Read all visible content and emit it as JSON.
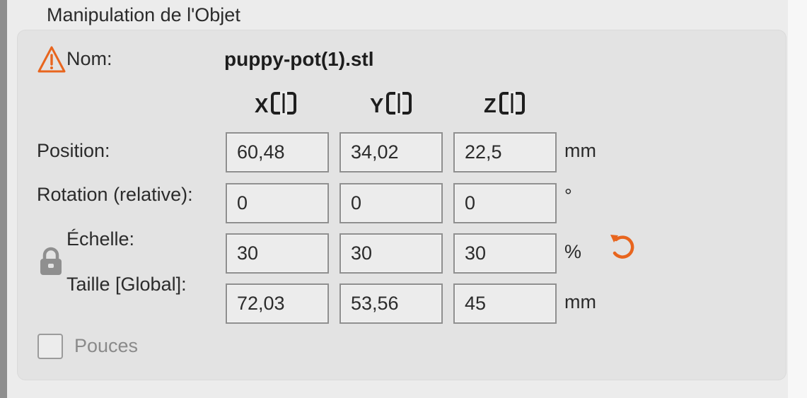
{
  "panel": {
    "title": "Manipulation de l'Objet"
  },
  "name_row": {
    "label": "Nom:",
    "value": "puppy-pot(1).stl",
    "warning_icon": "warning-triangle-icon"
  },
  "axes": [
    {
      "label": "X",
      "icon": "axis-drop-icon"
    },
    {
      "label": "Y",
      "icon": "axis-drop-icon"
    },
    {
      "label": "Z",
      "icon": "axis-drop-icon"
    }
  ],
  "rows": {
    "position": {
      "label": "Position:",
      "values": [
        "60,48",
        "34,02",
        "22,5"
      ],
      "unit": "mm"
    },
    "rotation": {
      "label": "Rotation (relative):",
      "values": [
        "0",
        "0",
        "0"
      ],
      "unit": "°"
    },
    "scale": {
      "label": "Échelle:",
      "values": [
        "30",
        "30",
        "30"
      ],
      "unit": "%"
    },
    "size": {
      "label": "Taille [Global]:",
      "values": [
        "72,03",
        "53,56",
        "45"
      ],
      "unit": "mm"
    }
  },
  "lock_icon": "padlock-icon",
  "reset_icon": "undo-arrow-icon",
  "inches": {
    "label": "Pouces",
    "checked": false
  },
  "colors": {
    "accent": "#e8651e",
    "panel_bg": "#e3e3e3",
    "field_border": "#8f8f8f"
  }
}
